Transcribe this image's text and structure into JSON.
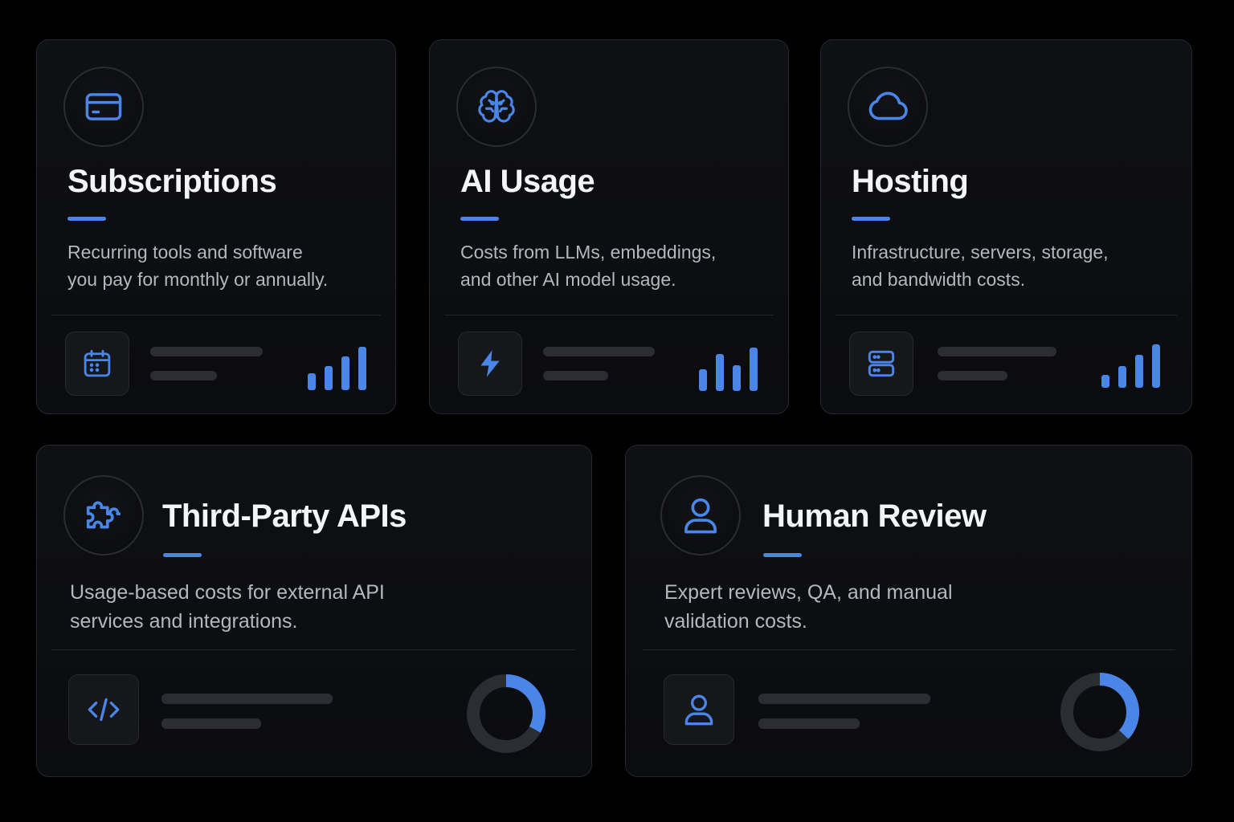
{
  "theme": {
    "background": "#000000",
    "card_background": "#0d0e11",
    "accent": "#4a86e8",
    "title_color": "#f4f5f7",
    "text_color": "#b4b7bd"
  },
  "cards": [
    {
      "id": "subscriptions",
      "icon": "credit-card-icon",
      "title": "Subscriptions",
      "description_line1": "Recurring tools and software",
      "description_line2": "you pay for monthly or annually.",
      "footer_icon": "calendar-icon",
      "indicator": "bar-chart",
      "bar_levels": [
        0.38,
        0.55,
        0.78,
        1.0
      ]
    },
    {
      "id": "ai-usage",
      "icon": "brain-icon",
      "title": "AI Usage",
      "description_line1": "Costs from LLMs, embeddings,",
      "description_line2": "and other AI model usage.",
      "footer_icon": "lightning-icon",
      "indicator": "bar-chart",
      "bar_levels": [
        0.5,
        0.85,
        0.6,
        1.0
      ]
    },
    {
      "id": "hosting",
      "icon": "cloud-icon",
      "title": "Hosting",
      "description_line1": "Infrastructure, servers, storage,",
      "description_line2": "and bandwidth costs.",
      "footer_icon": "server-icon",
      "indicator": "bar-chart",
      "bar_levels": [
        0.3,
        0.5,
        0.75,
        1.0
      ]
    },
    {
      "id": "third-party-apis",
      "icon": "puzzle-icon",
      "title": "Third-Party APIs",
      "description_line1": "Usage-based costs for external API",
      "description_line2": "services and integrations.",
      "footer_icon": "code-icon",
      "indicator": "donut",
      "donut_fraction": 0.33
    },
    {
      "id": "human-review",
      "icon": "user-icon",
      "title": "Human Review",
      "description_line1": "Expert reviews, QA, and manual",
      "description_line2": "validation costs.",
      "footer_icon": "user-icon",
      "indicator": "donut",
      "donut_fraction": 0.37
    }
  ]
}
